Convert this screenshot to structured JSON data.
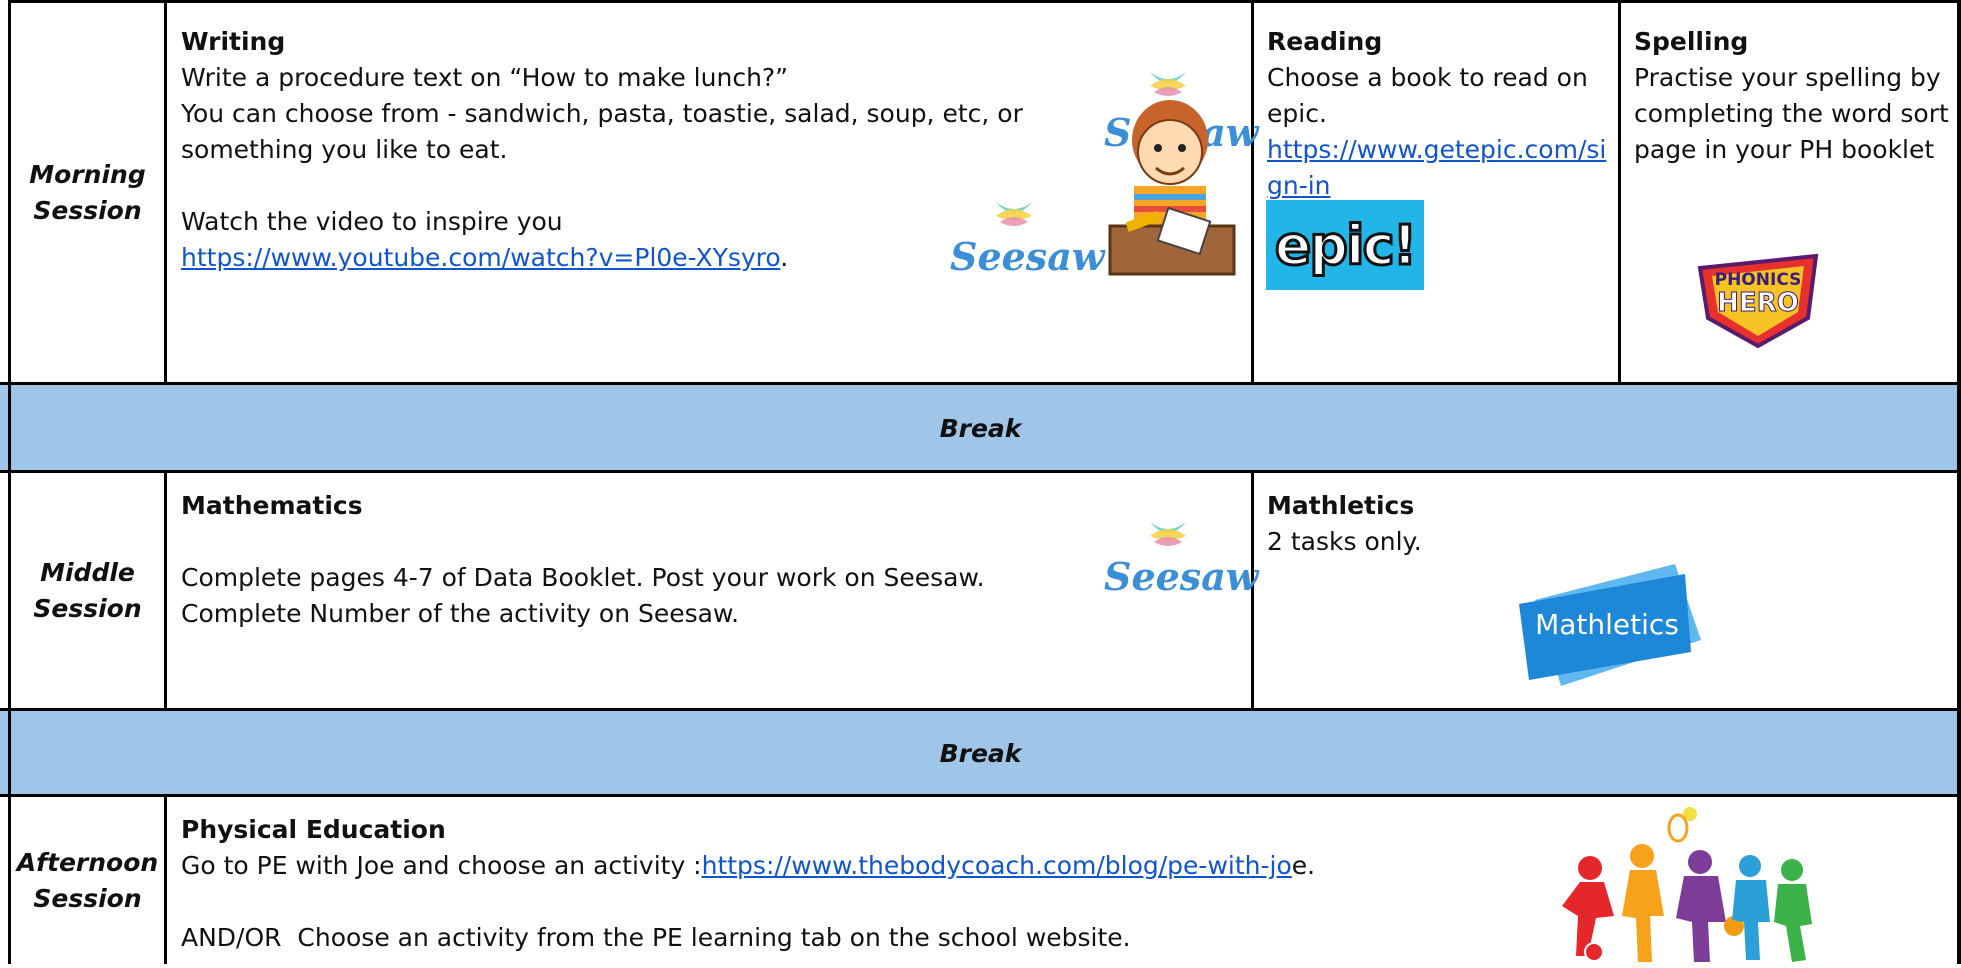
{
  "colors": {
    "break_bg": "#9fc5e8",
    "link": "#1155cc",
    "seesaw_blue": "#3a8fd6",
    "epic_bg": "#22b5e8",
    "mathletics_blue": "#1e88d8"
  },
  "morning": {
    "label": "Morning Session",
    "writing": {
      "title": "Writing",
      "line1": "Write a procedure text on “How to make lunch?”",
      "line2": "You can choose from - sandwich, pasta, toastie, salad, soup, etc, or something you like to eat.",
      "line3": "Watch the video to inspire you",
      "link": "https://www.youtube.com/watch?v=Pl0e-XYsyro",
      "link_suffix": ".",
      "logo_text_1": "Seesaw",
      "logo_text_2": "Seesaw",
      "icons": [
        "seesaw-logo",
        "boy-writing-illustration"
      ]
    },
    "reading": {
      "title": "Reading",
      "text": "Choose a book to read on epic.",
      "link": "https://www.getepic.com/sign-in",
      "logo_text": "epic!",
      "icon": "epic-logo"
    },
    "spelling": {
      "title": "Spelling",
      "text": "Practise your spelling by completing the word sort page in your PH booklet",
      "logo_line1": "PHONICS",
      "logo_line2": "HERO",
      "icon": "phonics-hero-logo"
    }
  },
  "break1": "Break",
  "middle": {
    "label": "Middle Session",
    "maths": {
      "title": "Mathematics",
      "line1": "Complete pages 4-7 of Data Booklet. Post your work on Seesaw.",
      "line2": "Complete Number of the activity on Seesaw.",
      "logo_text": "Seesaw",
      "icon": "seesaw-logo"
    },
    "mathletics": {
      "title": "Mathletics",
      "text": "2 tasks only.",
      "logo_text": "Mathletics",
      "icon": "mathletics-logo"
    }
  },
  "break2": "Break",
  "afternoon": {
    "label": "Afternoon Session",
    "pe": {
      "title": "Physical Education",
      "line1_prefix": "Go to PE with Joe and choose an activity :",
      "link": "https://www.thebodycoach.com/blog/pe-with-jo",
      "line1_suffix": "e.",
      "line2": "AND/OR  Choose an activity from the PE learning tab on the school website.",
      "icon": "sports-silhouettes-illustration"
    }
  }
}
